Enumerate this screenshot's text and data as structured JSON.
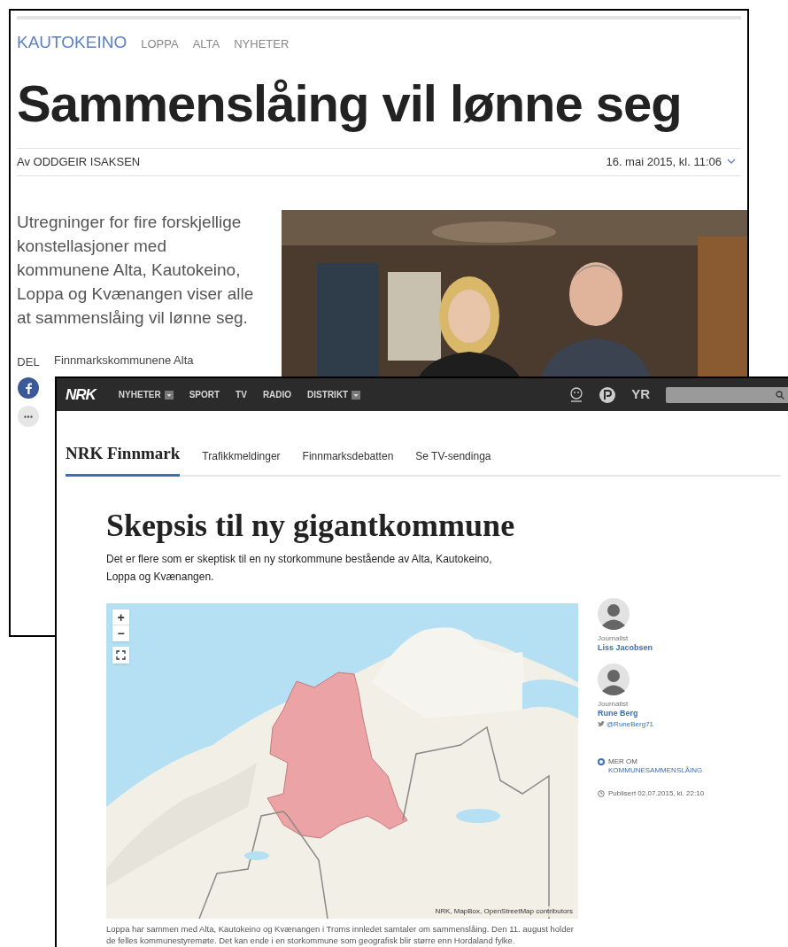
{
  "back_article": {
    "tags": [
      {
        "label": "KAUTOKEINO",
        "selected": true
      },
      {
        "label": "LOPPA",
        "selected": false
      },
      {
        "label": "ALTA",
        "selected": false
      },
      {
        "label": "NYHETER",
        "selected": false
      }
    ],
    "headline": "Sammenslåing vil lønne seg",
    "byline": "Av ODDGEIR ISAKSEN",
    "date": "16. mai 2015, kl. 11:06",
    "lead": "Utregninger for fire forskjellige konstellasjoner med kommunene Alta, Kautokeino, Loppa og Kvænangen viser alle at sammenslåing vil lønne seg.",
    "share_label": "DEL",
    "body_fragment": "Finnmarkskommunene Alta"
  },
  "front_article": {
    "nav": {
      "logo": "NRK",
      "items": [
        {
          "label": "NYHETER",
          "dropdown": true
        },
        {
          "label": "SPORT",
          "dropdown": false
        },
        {
          "label": "TV",
          "dropdown": false
        },
        {
          "label": "RADIO",
          "dropdown": false
        },
        {
          "label": "DISTRIKT",
          "dropdown": true
        }
      ],
      "weather_link": "YR"
    },
    "subnav": {
      "title": "NRK Finnmark",
      "links": [
        "Trafikkmeldinger",
        "Finnmarksdebatten",
        "Se TV-sendinga"
      ]
    },
    "headline": "Skepsis til ny gigantkommune",
    "lead": "Det er flere som er skeptisk til en ny storkommune bestående av Alta, Kautokeino, Loppa og Kvænangen.",
    "map": {
      "zoom_in": "+",
      "zoom_out": "−",
      "attribution": "NRK, MapBox, OpenStreetMap contributors"
    },
    "caption": "Loppa har sammen med Alta, Kautokeino og Kvænangen i Troms innledet samtaler om sammenslåing. Den 11. august holder de felles kommunestyremøte. Det kan ende i en storkommune som geografisk blir større enn Hordaland fylke.",
    "authors": [
      {
        "role": "Journalist",
        "name": "Liss Jacobsen"
      },
      {
        "role": "Journalist",
        "name": "Rune Berg",
        "twitter": "@RuneBerg71"
      }
    ],
    "topic": {
      "label": "MER OM",
      "link": "KOMMUNESAMMENSLÅING"
    },
    "published": "Publisert 02.07.2015, kl. 22:10"
  }
}
